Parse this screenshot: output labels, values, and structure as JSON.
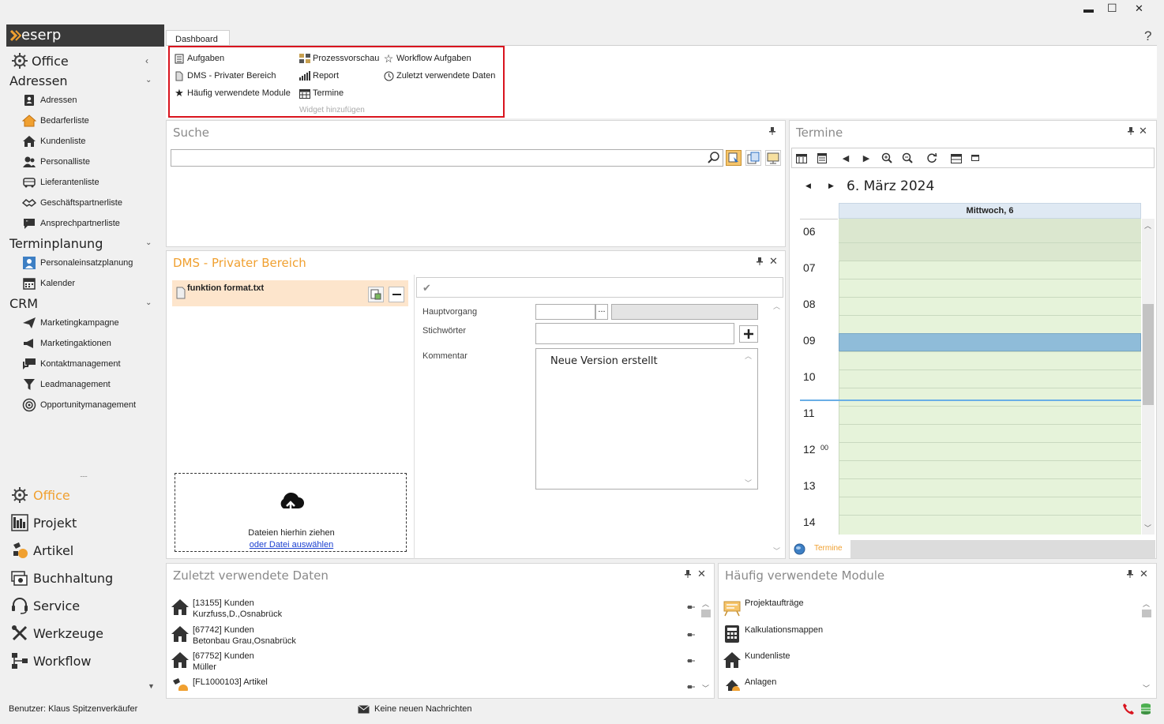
{
  "window": {
    "minimize": "▬",
    "maximize": "☐",
    "close": "✕",
    "help": "?"
  },
  "logo": "eserp",
  "tabs": [
    {
      "label": "Dashboard"
    }
  ],
  "widgets": {
    "col1": [
      "Aufgaben",
      "DMS - Privater Bereich",
      "Häufig verwendete Module"
    ],
    "col2": [
      "Prozessvorschau",
      "Report",
      "Termine"
    ],
    "col3": [
      "Workflow Aufgaben",
      "Zuletzt verwendete Daten"
    ],
    "footer": "Widget hinzufügen"
  },
  "sidebar": {
    "office": "Office",
    "adressen": {
      "title": "Adressen",
      "items": [
        "Adressen",
        "Bedarferliste",
        "Kundenliste",
        "Personalliste",
        "Lieferantenliste",
        "Geschäftspartnerliste",
        "Ansprechpartnerliste"
      ]
    },
    "terminplanung": {
      "title": "Terminplanung",
      "items": [
        "Personaleinsatzplanung",
        "Kalender"
      ]
    },
    "crm": {
      "title": "CRM",
      "items": [
        "Marketingkampagne",
        "Marketingaktionen",
        "Kontaktmanagement",
        "Leadmanagement",
        "Opportunitymanagement"
      ]
    },
    "splitter": "......",
    "modules": [
      "Office",
      "Projekt",
      "Artikel",
      "Buchhaltung",
      "Service",
      "Werkzeuge",
      "Workflow"
    ]
  },
  "suche": {
    "title": "Suche",
    "pin": "📌",
    "placeholder": ""
  },
  "dms": {
    "title": "DMS - Privater Bereich",
    "file": "funktion format.txt",
    "drop_text": "Dateien hierhin ziehen",
    "drop_link": "oder Datei auswählen",
    "labels": {
      "hauptvorgang": "Hauptvorgang",
      "stichwoerter": "Stichwörter",
      "kommentar": "Kommentar"
    },
    "kommentar_value": "Neue Version erstellt",
    "browse": "..."
  },
  "termine": {
    "title": "Termine",
    "date": "6. März 2024",
    "day_header": "Mittwoch, 6",
    "hours": [
      "06",
      "07",
      "08",
      "09",
      "10",
      "11",
      "12",
      "13",
      "14"
    ],
    "minute_label": "00",
    "footer_tab": "Termine"
  },
  "zuletzt": {
    "title": "Zuletzt verwendete Daten",
    "items": [
      {
        "line1": "[13155] Kunden",
        "line2": "Kurzfuss,D.,Osnabrück"
      },
      {
        "line1": "[67742] Kunden",
        "line2": "Betonbau Grau,Osnabrück"
      },
      {
        "line1": "[67752] Kunden",
        "line2": "Müller"
      },
      {
        "line1": "[FL1000103] Artikel",
        "line2": ""
      }
    ]
  },
  "haeufig": {
    "title": "Häufig verwendete Module",
    "items": [
      "Projektaufträge",
      "Kalkulationsmappen",
      "Kundenliste",
      "Anlagen"
    ]
  },
  "status": {
    "user": "Benutzer: Klaus Spitzenverkäufer",
    "messages": "Keine neuen Nachrichten"
  },
  "colors": {
    "accent": "#f0a030",
    "red_box": "#d9141e",
    "calendar_green": "#e6f3da",
    "event_blue": "#8fbcd9",
    "now_line": "#6aaee6"
  }
}
